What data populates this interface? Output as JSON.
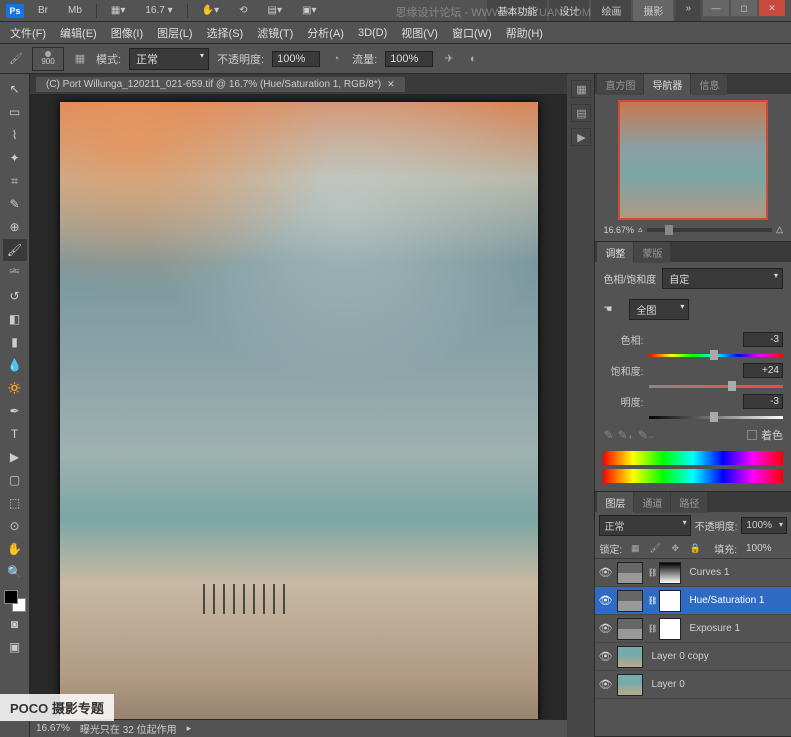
{
  "app_logo": "Ps",
  "top_toolbar": {
    "zoom_pct": "16.7",
    "workspace_tabs": [
      "基本功能",
      "设计",
      "绘画",
      "摄影"
    ],
    "active_workspace": 3
  },
  "menu": [
    "文件(F)",
    "编辑(E)",
    "图像(I)",
    "图层(L)",
    "选择(S)",
    "滤镜(T)",
    "分析(A)",
    "3D(D)",
    "视图(V)",
    "窗口(W)",
    "帮助(H)"
  ],
  "options_bar": {
    "brush_size": "900",
    "mode_label": "模式:",
    "mode_value": "正常",
    "opacity_label": "不透明度:",
    "opacity_value": "100%",
    "flow_label": "流量:",
    "flow_value": "100%"
  },
  "document": {
    "tab_title": "(C) Port Willunga_120211_021-659.tif @ 16.7% (Hue/Saturation 1, RGB/8*)"
  },
  "status": {
    "zoom": "16.67%",
    "info": "曝光只在 32 位起作用"
  },
  "navigator": {
    "tabs": [
      "直方图",
      "导航器",
      "信息"
    ],
    "active_tab": 1,
    "zoom": "16.67%"
  },
  "adjustments": {
    "tabs": [
      "调整",
      "蒙版"
    ],
    "type_label": "色相/饱和度",
    "preset_value": "自定",
    "range_value": "全图",
    "hue": {
      "label": "色相:",
      "value": "-3",
      "pos": 48
    },
    "saturation": {
      "label": "饱和度:",
      "value": "+24",
      "pos": 62
    },
    "lightness": {
      "label": "明度:",
      "value": "-3",
      "pos": 48
    },
    "colorize_label": "着色"
  },
  "layers_panel": {
    "tabs": [
      "图层",
      "通道",
      "路径"
    ],
    "blend_mode": "正常",
    "opacity_label": "不透明度:",
    "opacity": "100%",
    "lock_label": "锁定:",
    "fill_label": "填充:",
    "fill": "100%",
    "layers": [
      {
        "name": "Curves 1",
        "type": "adj",
        "mask": "grad",
        "selected": false
      },
      {
        "name": "Hue/Saturation 1",
        "type": "adj",
        "mask": "white",
        "selected": true
      },
      {
        "name": "Exposure 1",
        "type": "adj",
        "mask": "white",
        "selected": false
      },
      {
        "name": "Layer 0 copy",
        "type": "img",
        "mask": null,
        "selected": false
      },
      {
        "name": "Layer 0",
        "type": "img",
        "mask": null,
        "selected": false
      }
    ]
  },
  "watermark": "POCO 摄影专题",
  "watermark2": "思缘设计论坛 - WWW.MISSYUAN.COM"
}
